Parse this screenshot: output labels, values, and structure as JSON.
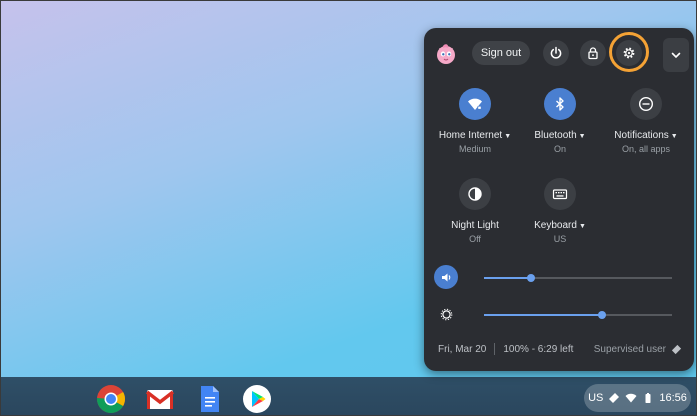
{
  "shelf": {
    "apps": [
      {
        "name": "Chrome"
      },
      {
        "name": "Gmail"
      },
      {
        "name": "Docs"
      },
      {
        "name": "Play Store"
      }
    ],
    "tray": {
      "ime": "US",
      "time": "16:56"
    }
  },
  "quick_settings": {
    "sign_out_label": "Sign out",
    "tiles": [
      {
        "label": "Home Internet",
        "sub": "Medium",
        "icon": "wifi-icon",
        "active": true
      },
      {
        "label": "Bluetooth",
        "sub": "On",
        "icon": "bluetooth-icon",
        "active": true
      },
      {
        "label": "Notifications",
        "sub": "On, all apps",
        "icon": "do-not-disturb-icon",
        "active": false
      },
      {
        "label": "Night Light",
        "sub": "Off",
        "icon": "night-light-icon",
        "active": false
      },
      {
        "label": "Keyboard",
        "sub": "US",
        "icon": "keyboard-icon",
        "active": false
      }
    ],
    "volume_level": 0.25,
    "brightness_level": 0.63,
    "footer": {
      "date": "Fri, Mar 20",
      "battery": "100% - 6:29 left",
      "supervised": "Supervised user"
    }
  },
  "colors": {
    "accent": "#4a7fd0",
    "highlight": "#f4a235",
    "panel": "#2b2d32"
  }
}
